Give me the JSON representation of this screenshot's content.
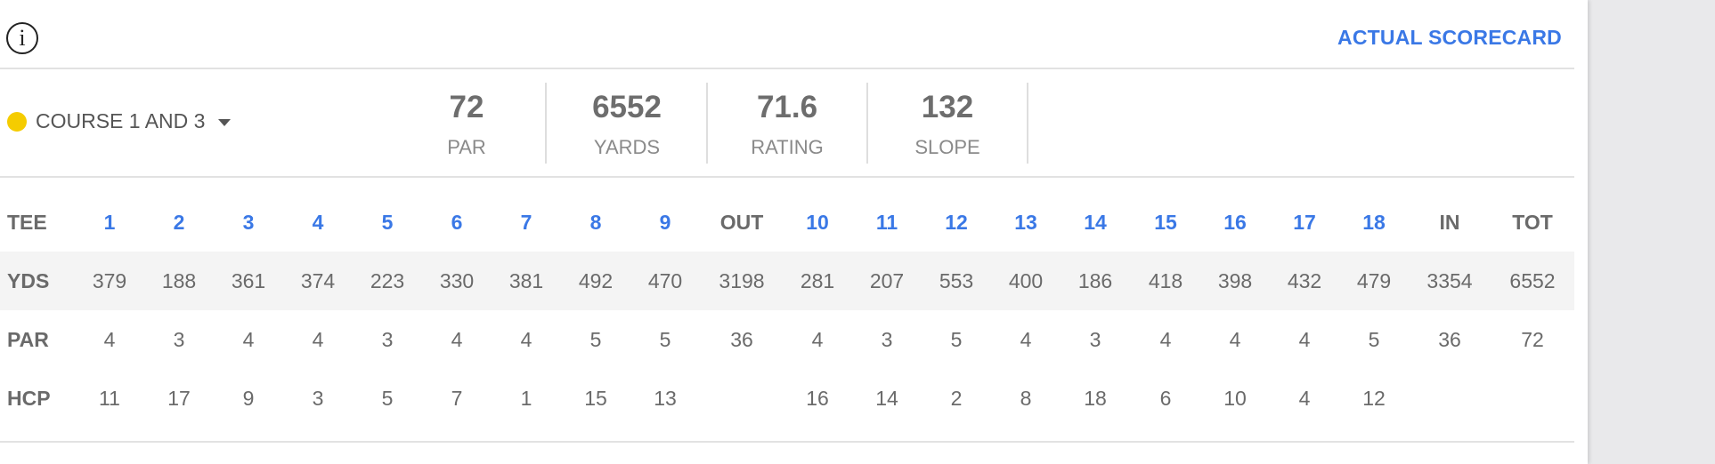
{
  "header": {
    "info_icon": "info-circle-icon",
    "actual_scorecard": "ACTUAL SCORECARD"
  },
  "course": {
    "name": "COURSE 1 AND 3",
    "color": "#f5cc00"
  },
  "stats": [
    {
      "value": "72",
      "label": "PAR"
    },
    {
      "value": "6552",
      "label": "YARDS"
    },
    {
      "value": "71.6",
      "label": "RATING"
    },
    {
      "value": "132",
      "label": "SLOPE"
    }
  ],
  "scorecard": {
    "columns": [
      "1",
      "2",
      "3",
      "4",
      "5",
      "6",
      "7",
      "8",
      "9",
      "OUT",
      "10",
      "11",
      "12",
      "13",
      "14",
      "15",
      "16",
      "17",
      "18",
      "IN",
      "TOT"
    ],
    "rows": [
      {
        "label": "TEE"
      },
      {
        "label": "YDS",
        "values": [
          "379",
          "188",
          "361",
          "374",
          "223",
          "330",
          "381",
          "492",
          "470",
          "3198",
          "281",
          "207",
          "553",
          "400",
          "186",
          "418",
          "398",
          "432",
          "479",
          "3354",
          "6552"
        ]
      },
      {
        "label": "PAR",
        "values": [
          "4",
          "3",
          "4",
          "4",
          "3",
          "4",
          "4",
          "5",
          "5",
          "36",
          "4",
          "3",
          "5",
          "4",
          "3",
          "4",
          "4",
          "4",
          "5",
          "36",
          "72"
        ]
      },
      {
        "label": "HCP",
        "values": [
          "11",
          "17",
          "9",
          "3",
          "5",
          "7",
          "1",
          "15",
          "13",
          "",
          "16",
          "14",
          "2",
          "8",
          "18",
          "6",
          "10",
          "4",
          "12",
          "",
          ""
        ]
      }
    ]
  },
  "colors": {
    "accent": "#3a78e6",
    "text": "#6a6a6a",
    "shaded_row": "#f4f4f4"
  }
}
